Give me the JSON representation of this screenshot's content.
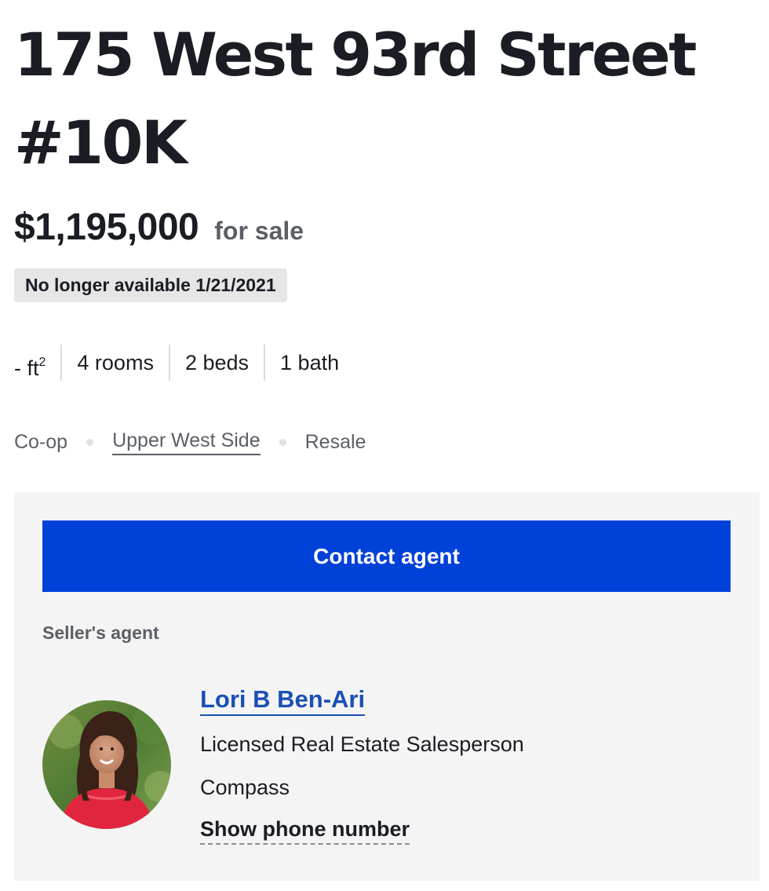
{
  "listing": {
    "title": "175 West 93rd Street #10K",
    "price": "$1,195,000",
    "sale_type": "for sale",
    "status": "No longer available 1/21/2021",
    "specs": {
      "area_value": "- ft",
      "area_unit_sup": "2",
      "rooms": "4 rooms",
      "beds": "2 beds",
      "baths": "1 bath"
    },
    "tags": {
      "building_type": "Co-op",
      "neighborhood": "Upper West Side",
      "market": "Resale"
    }
  },
  "agent_panel": {
    "contact_button": "Contact agent",
    "section_label": "Seller's agent",
    "agent": {
      "name": "Lori B Ben-Ari",
      "role": "Licensed Real Estate Salesperson",
      "company": "Compass",
      "phone_link": "Show phone number",
      "avatar_icon": "agent-portrait-photo"
    }
  },
  "colors": {
    "title": "#1a1d24",
    "muted": "#5b5f66",
    "badge_bg": "#e6e6e6",
    "panel_bg": "#f4f4f4",
    "button_bg": "#0041d9",
    "link": "#1a4fb5"
  }
}
